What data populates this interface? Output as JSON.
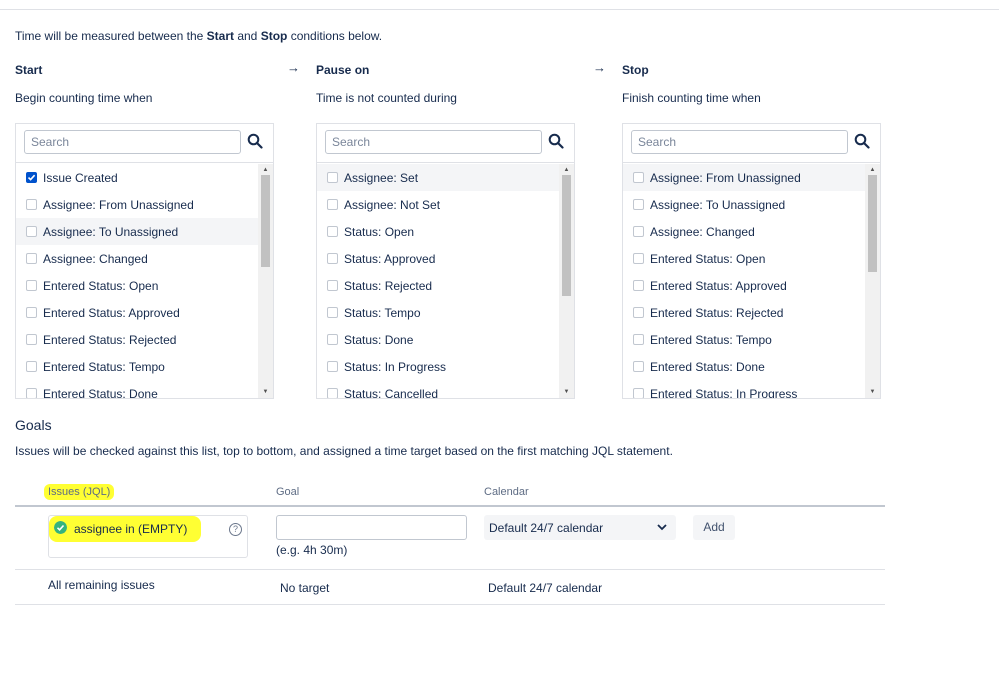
{
  "intro": {
    "prefix": "Time will be measured between the ",
    "start": "Start",
    "and": " and ",
    "stop": "Stop",
    "suffix": " conditions below."
  },
  "columns": [
    {
      "title": "Start",
      "subtitle": "Begin counting time when",
      "search_placeholder": "Search",
      "items": [
        {
          "label": "Issue Created",
          "checked": true
        },
        {
          "label": "Assignee: From Unassigned",
          "checked": false
        },
        {
          "label": "Assignee: To Unassigned",
          "checked": false
        },
        {
          "label": "Assignee: Changed",
          "checked": false
        },
        {
          "label": "Entered Status: Open",
          "checked": false
        },
        {
          "label": "Entered Status: Approved",
          "checked": false
        },
        {
          "label": "Entered Status: Rejected",
          "checked": false
        },
        {
          "label": "Entered Status: Tempo",
          "checked": false
        },
        {
          "label": "Entered Status: Done",
          "checked": false
        }
      ]
    },
    {
      "title": "Pause on",
      "subtitle": "Time is not counted during",
      "search_placeholder": "Search",
      "items": [
        {
          "label": "Assignee: Set",
          "checked": false
        },
        {
          "label": "Assignee: Not Set",
          "checked": false
        },
        {
          "label": "Status: Open",
          "checked": false
        },
        {
          "label": "Status: Approved",
          "checked": false
        },
        {
          "label": "Status: Rejected",
          "checked": false
        },
        {
          "label": "Status: Tempo",
          "checked": false
        },
        {
          "label": "Status: Done",
          "checked": false
        },
        {
          "label": "Status: In Progress",
          "checked": false
        },
        {
          "label": "Status: Cancelled",
          "checked": false
        }
      ]
    },
    {
      "title": "Stop",
      "subtitle": "Finish counting time when",
      "search_placeholder": "Search",
      "items": [
        {
          "label": "Assignee: From Unassigned",
          "checked": false
        },
        {
          "label": "Assignee: To Unassigned",
          "checked": false
        },
        {
          "label": "Assignee: Changed",
          "checked": false
        },
        {
          "label": "Entered Status: Open",
          "checked": false
        },
        {
          "label": "Entered Status: Approved",
          "checked": false
        },
        {
          "label": "Entered Status: Rejected",
          "checked": false
        },
        {
          "label": "Entered Status: Tempo",
          "checked": false
        },
        {
          "label": "Entered Status: Done",
          "checked": false
        },
        {
          "label": "Entered Status: In Progress",
          "checked": false
        }
      ]
    }
  ],
  "arrow_glyph": "→",
  "goals": {
    "title": "Goals",
    "description": "Issues will be checked against this list, top to bottom, and assigned a time target based on the first matching JQL statement.",
    "headers": {
      "issues": "Issues (JQL)",
      "goal": "Goal",
      "calendar": "Calendar"
    },
    "new_row": {
      "jql_value": "assignee in (EMPTY)",
      "help_glyph": "?",
      "goal_value": "",
      "goal_hint": "(e.g. 4h 30m)",
      "calendar": "Default 24/7 calendar",
      "add_label": "Add"
    },
    "remaining_row": {
      "issues": "All remaining issues",
      "goal": "No target",
      "calendar": "Default 24/7 calendar"
    }
  },
  "colors": {
    "highlight": "#ffff33",
    "accent": "#0052cc",
    "valid": "#36b37e"
  }
}
